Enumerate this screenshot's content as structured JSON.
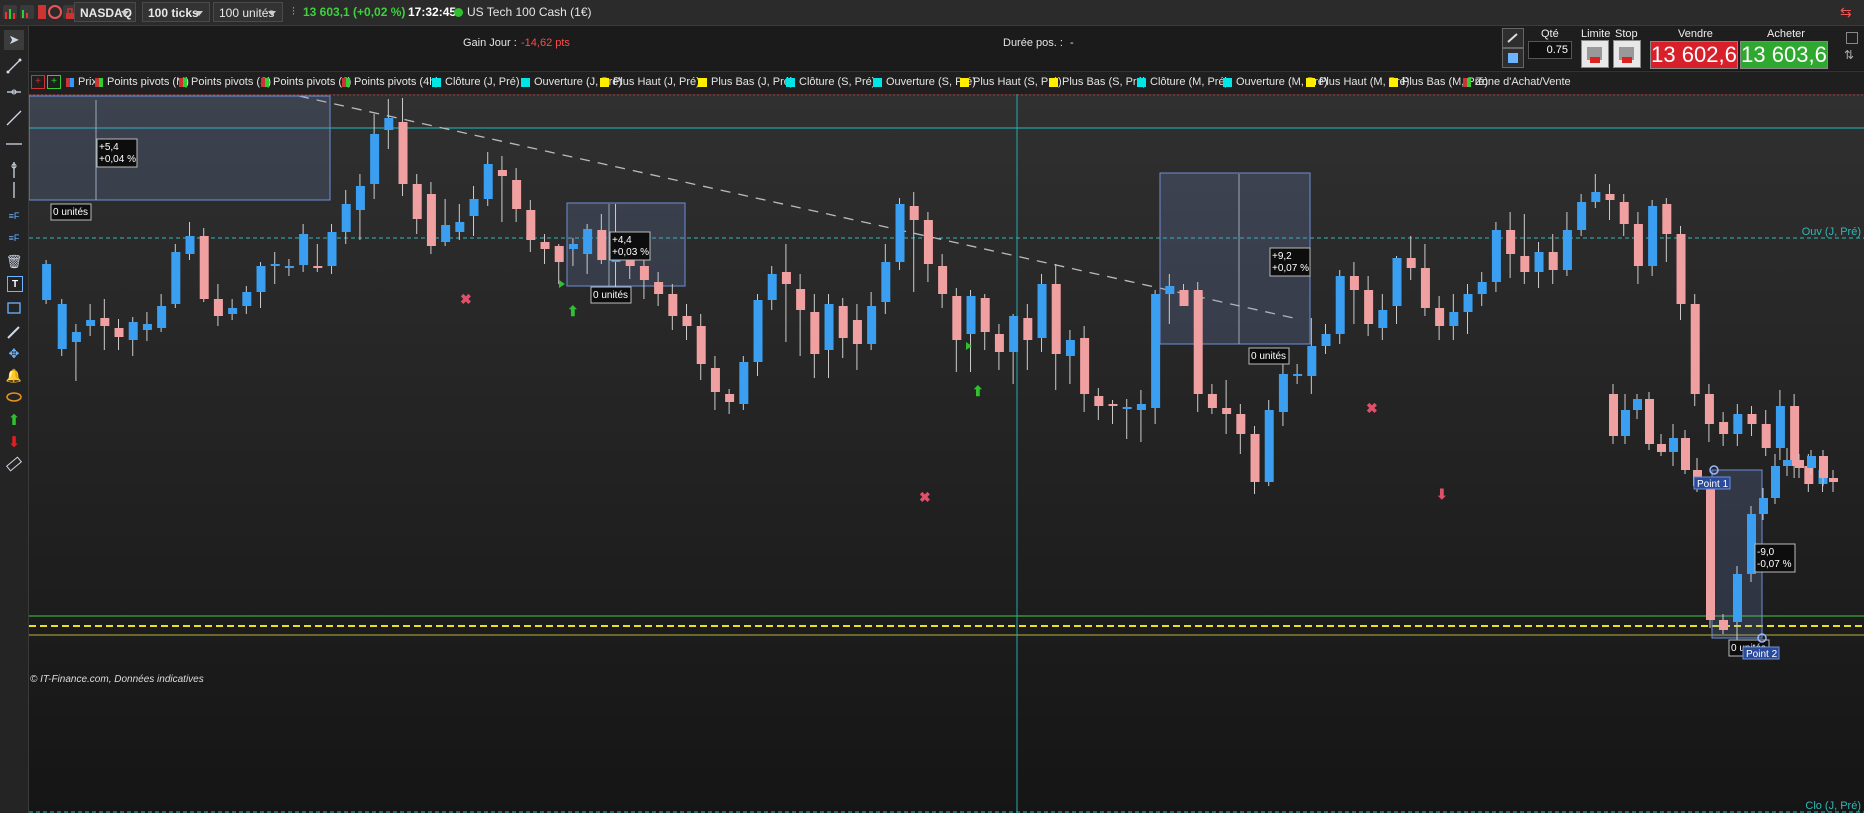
{
  "toolbar": {
    "market": "NASDAQ",
    "timeframe": "100 ticks",
    "quantity": "100 unités",
    "quote": "13 603,1 (+0,02 %)",
    "time": "17:32:45",
    "instrument": "US Tech 100 Cash (1€)"
  },
  "info": {
    "gain_label": "Gain Jour :",
    "gain_value": "-14,62 pts",
    "duration_label": "Durée pos. :",
    "duration_value": "-"
  },
  "trade": {
    "qty_label": "Qté",
    "qty_value": "0.75",
    "limit_label": "Limite",
    "stop_label": "Stop",
    "sell_label": "Vendre",
    "sell_price": "13 602,6",
    "buy_label": "Acheter",
    "buy_price": "13 603,6"
  },
  "indicators": [
    {
      "label": "Prix",
      "color": "#cc3333",
      "color2": "#3399ff"
    },
    {
      "label": "Points pivots (M)",
      "color": "#cc3333",
      "color2": "#33cc33"
    },
    {
      "label": "Points pivots (S)",
      "color": "#cc3333",
      "color2": "#33cc33"
    },
    {
      "label": "Points pivots (J)",
      "color": "#cc3333",
      "color2": "#33cc33"
    },
    {
      "label": "Points pivots (4h)",
      "color": "#cc3333",
      "color2": "#33cc33"
    },
    {
      "label": "Clôture (J, Pré)",
      "color": "#00e5e5"
    },
    {
      "label": "Ouverture (J, Pré)",
      "color": "#00e5e5"
    },
    {
      "label": "Plus Haut (J, Pré)",
      "color": "#ffee00"
    },
    {
      "label": "Plus Bas (J, Pré)",
      "color": "#ffee00"
    },
    {
      "label": "Clôture (S, Pré)",
      "color": "#00e5e5"
    },
    {
      "label": "Ouverture (S, Pré)",
      "color": "#00e5e5"
    },
    {
      "label": "Plus Haut (S, Pré)",
      "color": "#ffee00"
    },
    {
      "label": "Plus Bas (S, Pré)",
      "color": "#ffee00"
    },
    {
      "label": "Clôture (M, Pré)",
      "color": "#00e5e5"
    },
    {
      "label": "Ouverture (M, Pré)",
      "color": "#00e5e5"
    },
    {
      "label": "Plus Haut (M, Pré)",
      "color": "#ffee00"
    },
    {
      "label": "Plus Bas (M, Pré)",
      "color": "#ffee00"
    },
    {
      "label": "Zone d'Achat/Vente",
      "color": "#cc3333",
      "color2": "#33cc33"
    }
  ],
  "chart": {
    "ref_line_top_label": "Ouv (J, Pré)",
    "ref_line_bottom_label": "Clo (J, Pré)",
    "watermark": "© IT-Finance.com, Données indicatives",
    "measures": [
      {
        "change": "+5,4",
        "pct": "+0,04 %",
        "units": "0 unités"
      },
      {
        "change": "+4,4",
        "pct": "+0,03 %",
        "units": "0 unités"
      },
      {
        "change": "+9,2",
        "pct": "+0,07 %",
        "units": "0 unités"
      },
      {
        "change": "-9,0",
        "pct": "-0,07 %",
        "units": "0 unités"
      }
    ],
    "point1_label": "Point 1",
    "point2_label": "Point 2"
  },
  "colors": {
    "bull": "#3a9ff0",
    "bear": "#f0a0a0",
    "sell": "#d8202a",
    "buy": "#2ea82e",
    "ref_cyan": "#2fb8b8",
    "green_line": "#3ecb3e",
    "yellow_line": "#e8e020"
  }
}
